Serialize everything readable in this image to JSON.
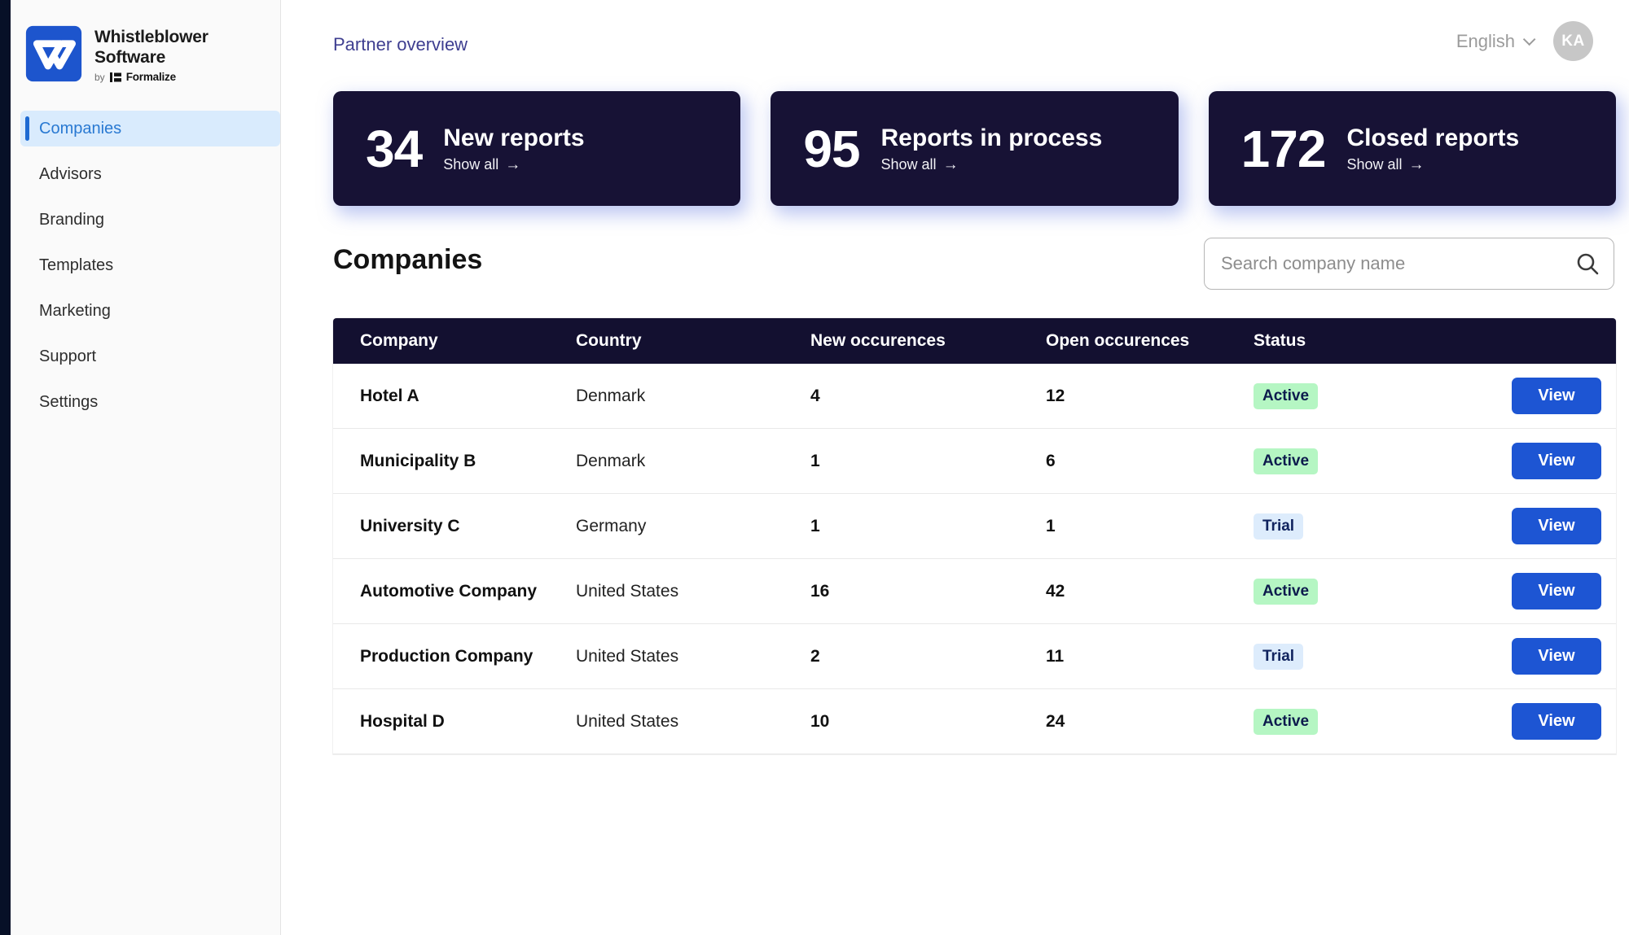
{
  "brand": {
    "name_line1": "Whistleblower",
    "name_line2": "Software",
    "by_label": "by",
    "by_brand": "Formalize"
  },
  "sidebar": {
    "active_item": "Companies",
    "items": [
      {
        "label": "Companies"
      },
      {
        "label": "Advisors"
      },
      {
        "label": "Branding"
      },
      {
        "label": "Templates"
      },
      {
        "label": "Marketing"
      },
      {
        "label": "Support"
      },
      {
        "label": "Settings"
      }
    ]
  },
  "topbar": {
    "breadcrumb": "Partner overview",
    "language": "English",
    "avatar_initials": "KA"
  },
  "icons": {
    "arrow_right": "→"
  },
  "stat_cards": [
    {
      "value": "34",
      "title": "New reports",
      "link_label": "Show all"
    },
    {
      "value": "95",
      "title": "Reports in process",
      "link_label": "Show all"
    },
    {
      "value": "172",
      "title": "Closed reports",
      "link_label": "Show all"
    }
  ],
  "companies": {
    "heading": "Companies",
    "search_placeholder": "Search company name"
  },
  "table": {
    "view_button_label": "View",
    "columns": {
      "company": "Company",
      "country": "Country",
      "new": "New occurences",
      "open": "Open occurences",
      "status": "Status"
    },
    "rows": [
      {
        "company": "Hotel A",
        "country": "Denmark",
        "new": "4",
        "open": "12",
        "status": "Active"
      },
      {
        "company": "Municipality B",
        "country": "Denmark",
        "new": "1",
        "open": "6",
        "status": "Active"
      },
      {
        "company": "University C",
        "country": "Germany",
        "new": "1",
        "open": "1",
        "status": "Trial"
      },
      {
        "company": "Automotive Company",
        "country": "United States",
        "new": "16",
        "open": "42",
        "status": "Active"
      },
      {
        "company": "Production Company",
        "country": "United States",
        "new": "2",
        "open": "11",
        "status": "Trial"
      },
      {
        "company": "Hospital D",
        "country": "United States",
        "new": "10",
        "open": "24",
        "status": "Active"
      }
    ]
  },
  "colors": {
    "dark_navy": "#171235",
    "table_header_navy": "#131030",
    "accent_blue": "#1d55d3",
    "sidebar_active_bg": "#d9ebfd",
    "sidebar_active_text": "#2979d2",
    "active_badge_bg": "#b5f6c3",
    "active_badge_text": "#0d1b4d",
    "trial_badge_bg": "#ddecfc",
    "trial_badge_text": "#10235e",
    "breadcrumb_text": "#3e3e90",
    "edge_strip": "#071027"
  }
}
